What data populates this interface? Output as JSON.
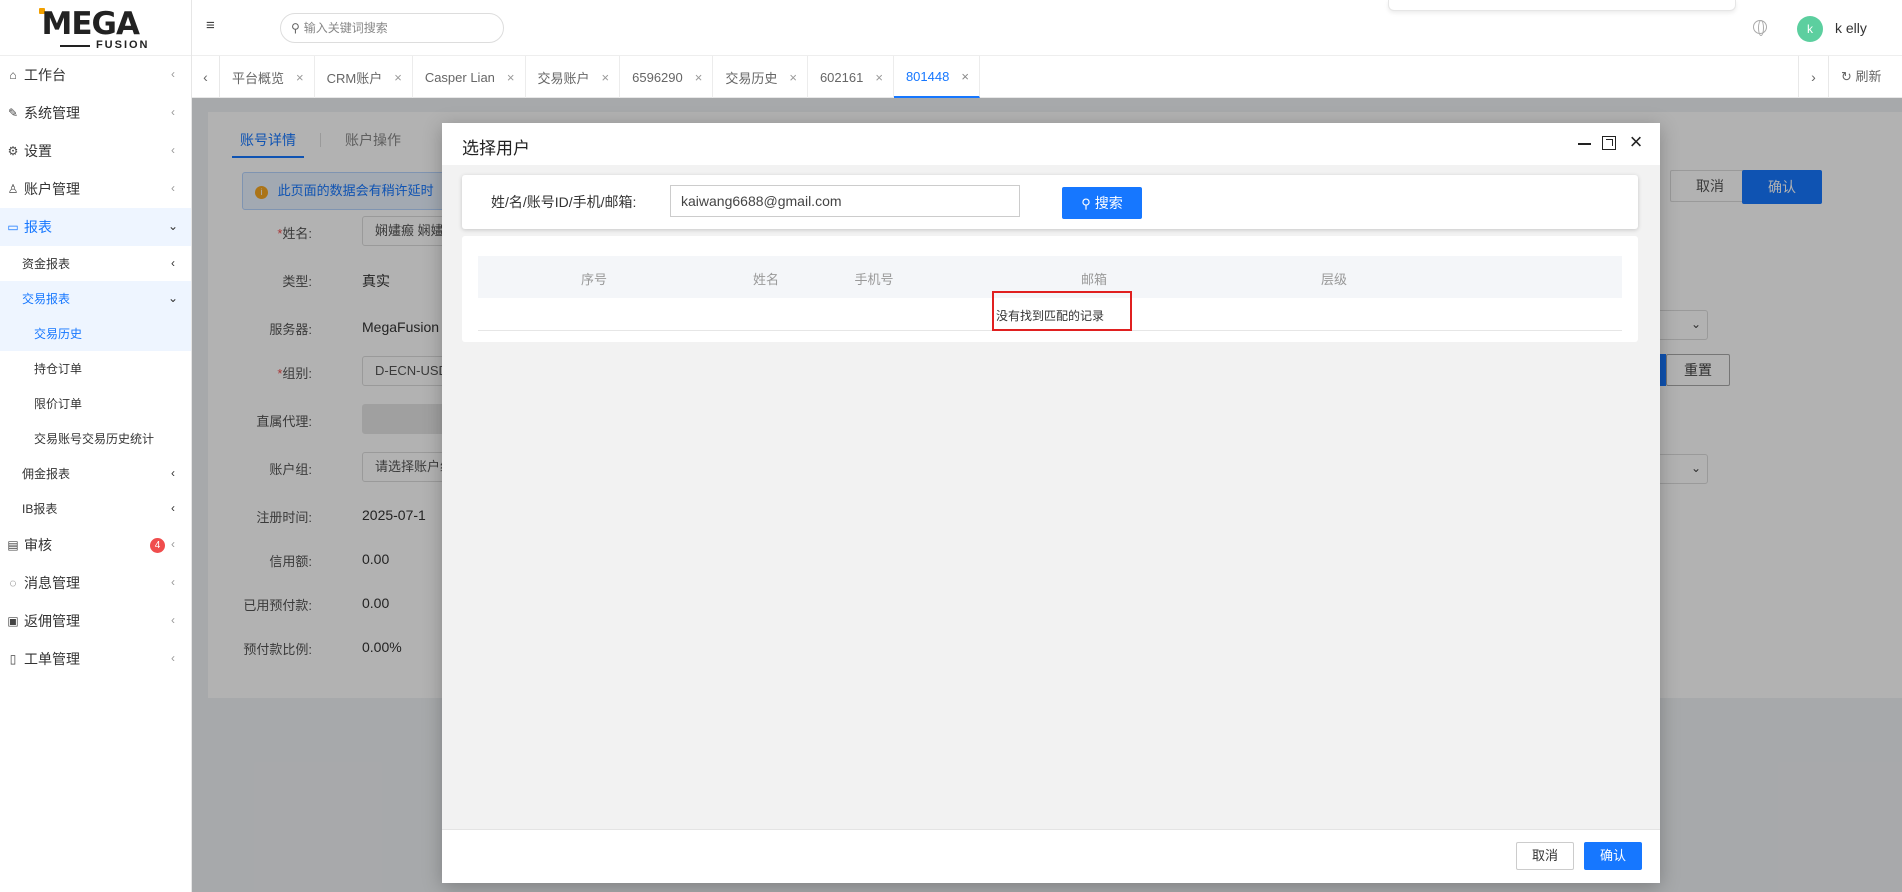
{
  "brand": {
    "logo_text": "MEGA",
    "logo_subtext": "FUSION"
  },
  "header": {
    "search_placeholder": "输入关键词搜索",
    "avatar_letter": "k",
    "username": "k elly"
  },
  "sidebar": {
    "items": [
      {
        "label": "工作台",
        "icon": "home-icon"
      },
      {
        "label": "系统管理",
        "icon": "tool-icon"
      },
      {
        "label": "设置",
        "icon": "gear-icon"
      },
      {
        "label": "账户管理",
        "icon": "user-icon"
      },
      {
        "label": "报表",
        "icon": "report-icon"
      },
      {
        "label": "审核",
        "icon": "audit-icon",
        "badge": "4"
      },
      {
        "label": "消息管理",
        "icon": "message-icon"
      },
      {
        "label": "返佣管理",
        "icon": "commission-icon"
      },
      {
        "label": "工单管理",
        "icon": "ticket-icon"
      }
    ],
    "report_children": [
      {
        "label": "资金报表"
      },
      {
        "label": "交易报表"
      },
      {
        "label": "佣金报表"
      },
      {
        "label": "IB报表"
      }
    ],
    "trade_report_children": [
      {
        "label": "交易历史"
      },
      {
        "label": "持仓订单"
      },
      {
        "label": "限价订单"
      },
      {
        "label": "交易账号交易历史统计"
      }
    ]
  },
  "tabs": {
    "items": [
      {
        "label": "平台概览"
      },
      {
        "label": "CRM账户"
      },
      {
        "label": "Casper Lian"
      },
      {
        "label": "交易账户"
      },
      {
        "label": "6596290"
      },
      {
        "label": "交易历史"
      },
      {
        "label": "602161"
      },
      {
        "label": "801448"
      }
    ],
    "active_index": 7,
    "close_glyph": "×",
    "refresh_label": "刷新"
  },
  "background": {
    "sub_tabs": [
      "账号详情",
      "账户操作"
    ],
    "notice": "此页面的数据会有稍许延时",
    "fields": [
      {
        "label": "姓名:",
        "required": true,
        "value": "娴嫿瘢 娴嫿",
        "kind": "input"
      },
      {
        "label": "类型:",
        "required": false,
        "value": "真实",
        "kind": "text"
      },
      {
        "label": "服务器:",
        "required": false,
        "value": "MegaFusion",
        "kind": "text"
      },
      {
        "label": "组别:",
        "required": true,
        "value": "D-ECN-USD",
        "kind": "input"
      },
      {
        "label": "直属代理:",
        "required": false,
        "value": "",
        "kind": "gray"
      },
      {
        "label": "账户组:",
        "required": false,
        "value": "请选择账户组",
        "kind": "input"
      },
      {
        "label": "注册时间:",
        "required": false,
        "value": "2025-07-1",
        "kind": "text"
      },
      {
        "label": "信用额:",
        "required": false,
        "value": "0.00",
        "kind": "text"
      },
      {
        "label": "已用预付款:",
        "required": false,
        "value": "0.00",
        "kind": "text"
      },
      {
        "label": "预付款比例:",
        "required": false,
        "value": "0.00%",
        "kind": "text"
      }
    ],
    "cancel_label": "取消",
    "confirm_label": "确认",
    "reset_label": "重置"
  },
  "modal": {
    "title": "选择用户",
    "search_label": "姓/名/账号ID/手机/邮箱:",
    "search_value": "kaiwang6688@gmail.com",
    "search_button": "搜索",
    "columns": [
      "序号",
      "姓名",
      "手机号",
      "邮箱",
      "层级"
    ],
    "empty_text": "没有找到匹配的记录",
    "cancel_label": "取消",
    "confirm_label": "确认"
  },
  "colors": {
    "primary": "#1677ff",
    "danger": "#e02020",
    "badge": "#f04d4d",
    "avatar": "#5ccf9f",
    "logo_accent": "#f2a000"
  }
}
